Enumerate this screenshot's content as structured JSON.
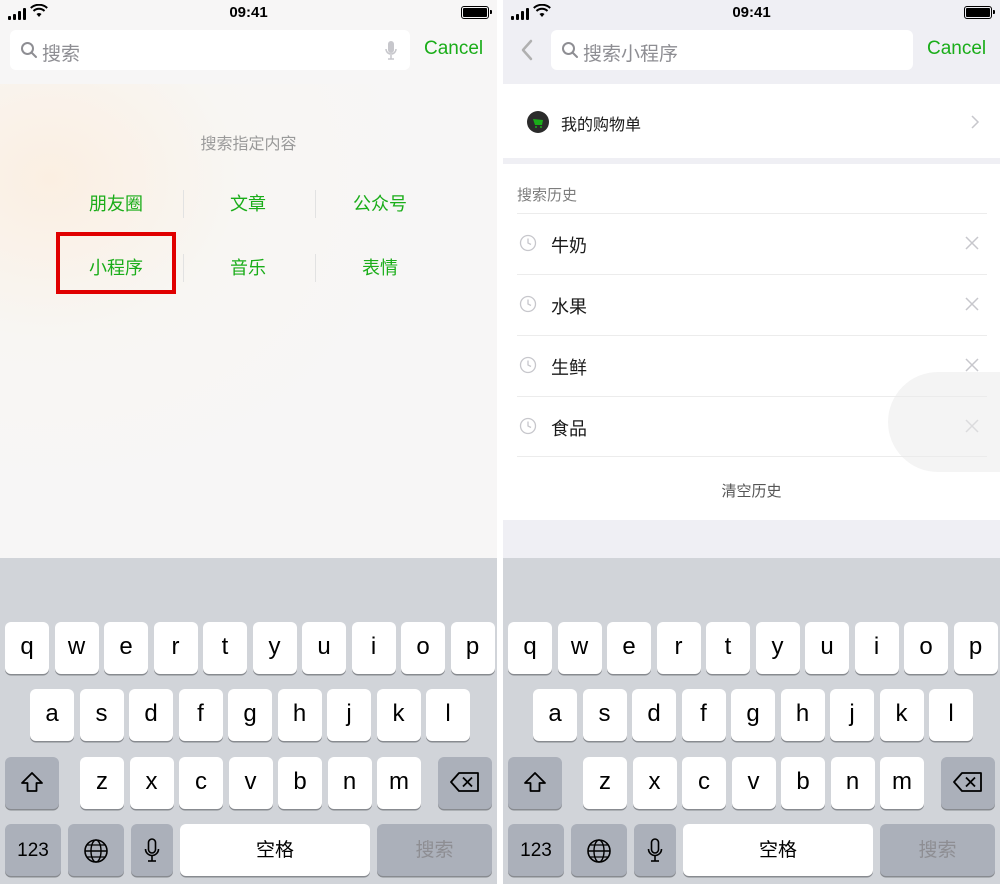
{
  "status_bar": {
    "time": "09:41"
  },
  "colors": {
    "accent_green": "#1aad19",
    "highlight_red": "#e00000",
    "keyboard_bg": "#d1d4d9"
  },
  "left": {
    "search": {
      "placeholder": "搜索",
      "cancel": "Cancel"
    },
    "hint": "搜索指定内容",
    "categories": [
      "朋友圈",
      "文章",
      "公众号",
      "小程序",
      "音乐",
      "表情"
    ],
    "highlighted_category": "小程序"
  },
  "right": {
    "search": {
      "placeholder": "搜索小程序",
      "cancel": "Cancel"
    },
    "mini_program": {
      "label": "我的购物单",
      "icon": "shopping-list-icon"
    },
    "history_title": "搜索历史",
    "history_items": [
      "牛奶",
      "水果",
      "生鲜",
      "食品"
    ],
    "clear_history": "清空历史"
  },
  "keyboard": {
    "row1": [
      "q",
      "w",
      "e",
      "r",
      "t",
      "y",
      "u",
      "i",
      "o",
      "p"
    ],
    "row2": [
      "a",
      "s",
      "d",
      "f",
      "g",
      "h",
      "j",
      "k",
      "l"
    ],
    "row3": [
      "z",
      "x",
      "c",
      "v",
      "b",
      "n",
      "m"
    ],
    "numbers_label": "123",
    "space_label": "空格",
    "return_label": "搜索",
    "icons": {
      "shift": "shift-icon",
      "delete": "delete-icon",
      "globe": "globe-icon",
      "mic": "microphone-icon"
    }
  }
}
